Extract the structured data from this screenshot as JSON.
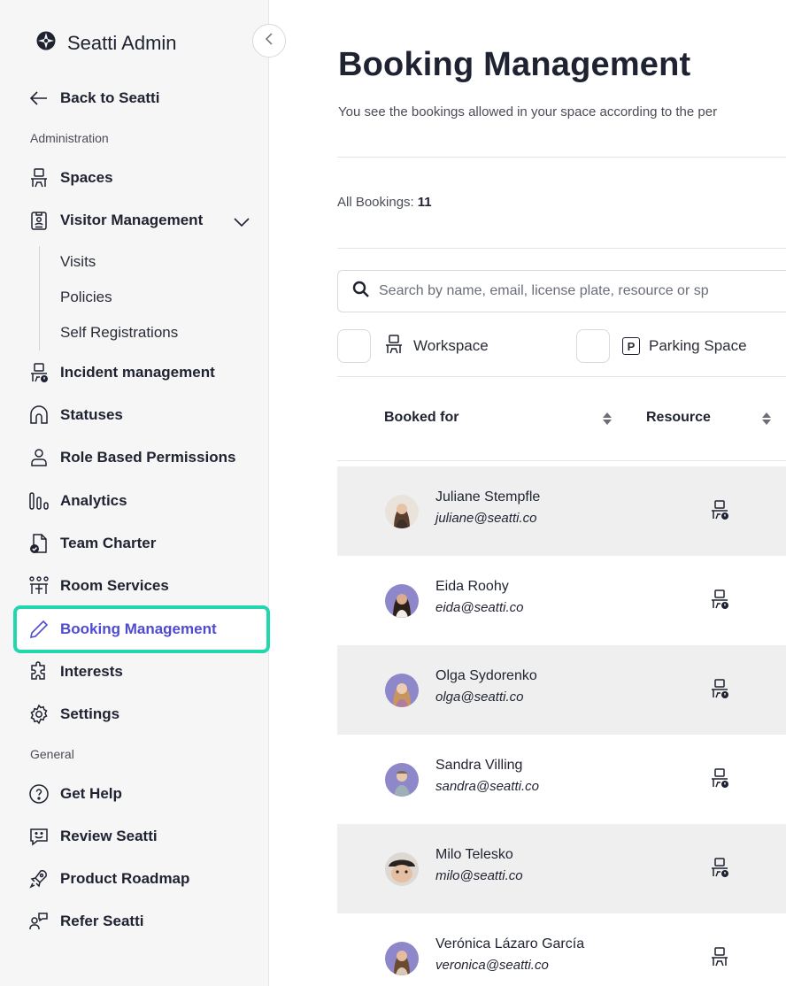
{
  "sidebar": {
    "brand": "Seatti Admin",
    "back": "Back to Seatti",
    "section_admin": "Administration",
    "spaces": "Spaces",
    "visitor_management": "Visitor Management",
    "visits": "Visits",
    "policies": "Policies",
    "self_registrations": "Self Registrations",
    "incident_management": "Incident management",
    "statuses": "Statuses",
    "role_based_permissions": "Role Based Permissions",
    "analytics": "Analytics",
    "team_charter": "Team Charter",
    "room_services": "Room Services",
    "booking_management": "Booking Management",
    "interests": "Interests",
    "settings": "Settings",
    "section_general": "General",
    "get_help": "Get Help",
    "review_seatti": "Review Seatti",
    "product_roadmap": "Product Roadmap",
    "refer_seatti": "Refer Seatti"
  },
  "main": {
    "title": "Booking Management",
    "subtitle": "You see the bookings allowed in your space according to the per",
    "all_bookings_label": "All Bookings:",
    "all_bookings_count": "11",
    "search_placeholder": "Search by name, email, license plate, resource or sp",
    "filters": {
      "workspace": "Workspace",
      "parking": "Parking Space",
      "parking_letter": "P"
    },
    "columns": {
      "booked_for": "Booked for",
      "resource": "Resource"
    }
  },
  "bookings": [
    {
      "name": "Juliane Stempfle",
      "email": "juliane@seatti.co",
      "resource_icon": "desk-status-icon"
    },
    {
      "name": "Eida Roohy",
      "email": "eida@seatti.co",
      "resource_icon": "desk-status-icon"
    },
    {
      "name": "Olga Sydorenko",
      "email": "olga@seatti.co",
      "resource_icon": "desk-status-icon"
    },
    {
      "name": "Sandra Villing",
      "email": "sandra@seatti.co",
      "resource_icon": "desk-status-icon"
    },
    {
      "name": "Milo Telesko",
      "email": "milo@seatti.co",
      "resource_icon": "desk-status-icon"
    },
    {
      "name": "Verónica Lázaro García",
      "email": "veronica@seatti.co",
      "resource_icon": "desk-icon"
    }
  ],
  "colors": {
    "accent": "#4f4bd0",
    "highlight": "#22d6ad",
    "row_alt": "#efeff0"
  }
}
